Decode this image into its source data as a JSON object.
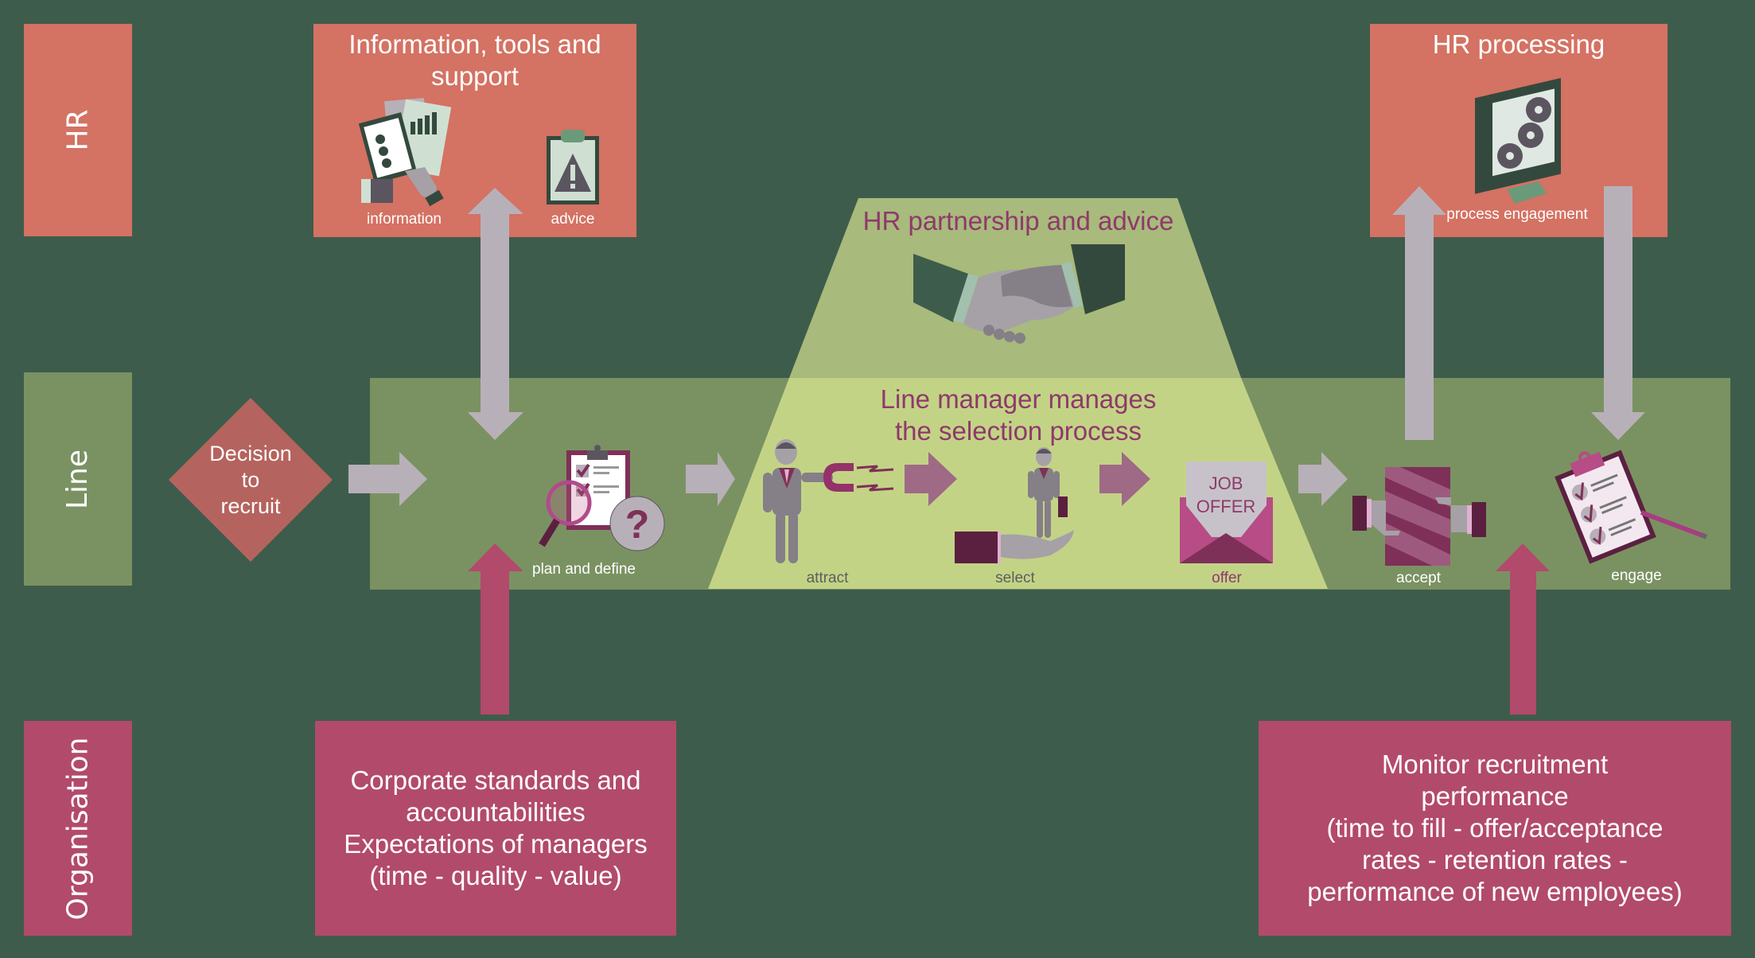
{
  "lanes": {
    "hr": "HR",
    "line": "Line",
    "organisation": "Organisation"
  },
  "hr_boxes": {
    "info_tools": {
      "title": "Information, tools and\nsupport",
      "icons": [
        {
          "name": "information-icon",
          "label": "information"
        },
        {
          "name": "advice-icon",
          "label": "advice"
        }
      ]
    },
    "hr_processing": {
      "title": "HR processing",
      "icon": {
        "name": "process-engagement-icon",
        "label": "process engagement"
      }
    }
  },
  "decision": {
    "text": "Decision\nto\nrecruit"
  },
  "partnership": {
    "title": "HR partnership and advice",
    "icon": "handshake-icon"
  },
  "selection": {
    "title": "Line manager manages\nthe selection process"
  },
  "steps": [
    {
      "name": "plan-and-define",
      "label": "plan and define",
      "icon": "clipboard-magnifier-question-icon"
    },
    {
      "name": "attract",
      "label": "attract",
      "icon": "businessman-magnet-icon"
    },
    {
      "name": "select",
      "label": "select",
      "icon": "hand-holding-businessman-icon"
    },
    {
      "name": "offer",
      "label": "offer",
      "icon": "job-offer-envelope-icon",
      "icon_text": "JOB\nOFFER"
    },
    {
      "name": "accept",
      "label": "accept",
      "icon": "handshake-document-icon"
    },
    {
      "name": "engage",
      "label": "engage",
      "icon": "checklist-clipboard-pencil-icon"
    }
  ],
  "organisation_boxes": {
    "standards": "Corporate standards and\naccountabilities\nExpectations of managers\n(time - quality - value)",
    "monitor": "Monitor recruitment\nperformance\n(time to fill - offer/acceptance\nrates - retention rates -\nperformance of new employees)"
  },
  "colors": {
    "background": "#3e5c4b",
    "hr": "#d47263",
    "line": "#7a9262",
    "organisation": "#b24a6c",
    "decision": "#b5635e",
    "trapezoid_upper": "#a8ba7c",
    "trapezoid_lower": "#c3d386",
    "arrow_gray": "#b8b0b8",
    "arrow_mauve": "#9e6a86",
    "accent_text": "#8e3a6a"
  }
}
